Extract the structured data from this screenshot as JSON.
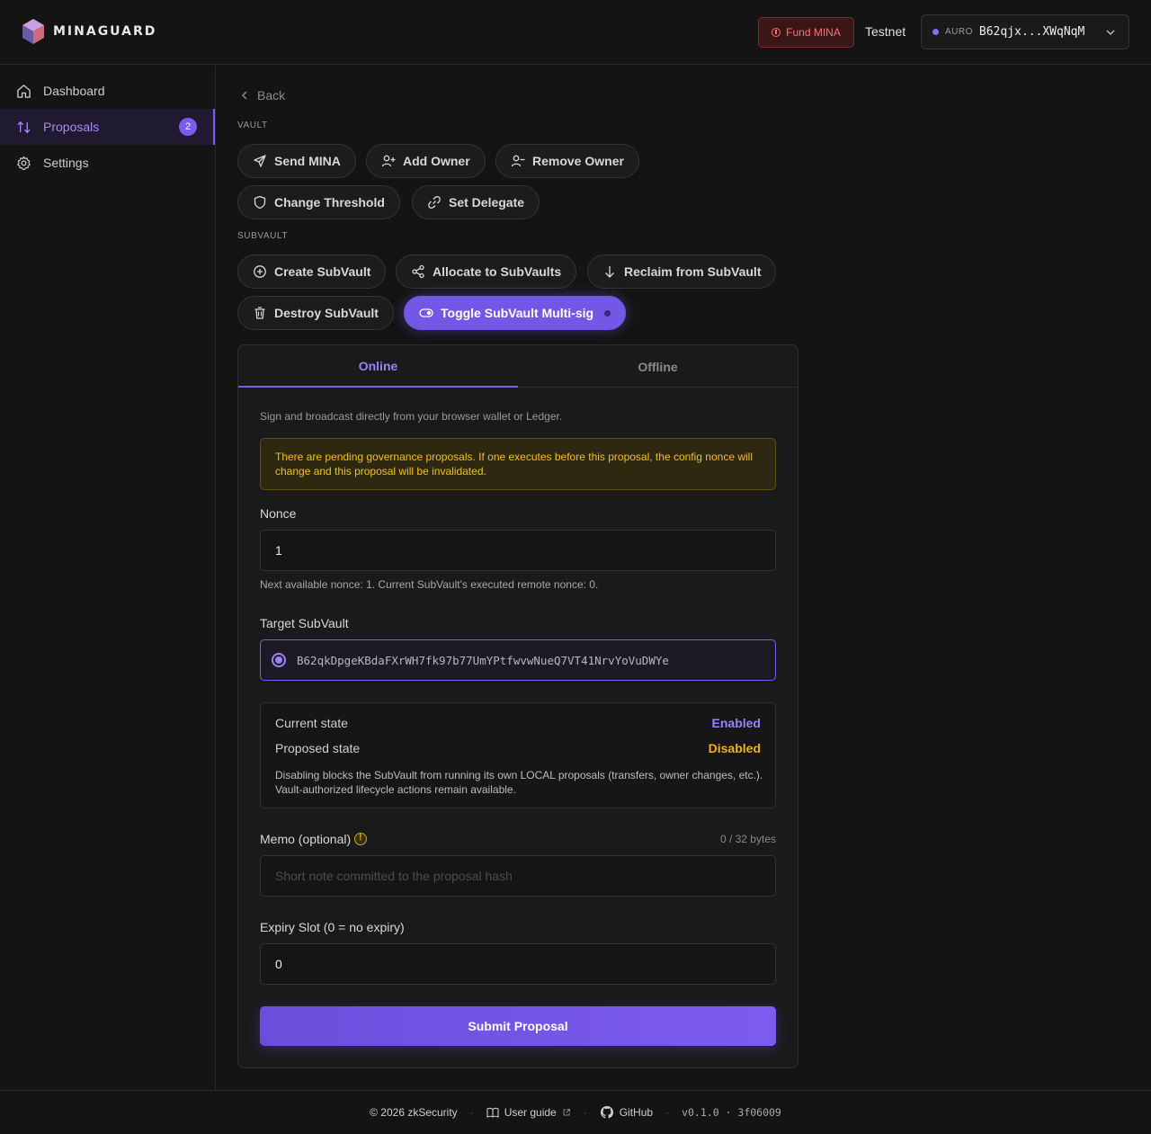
{
  "header": {
    "brand": "MINAGUARD",
    "fund_label": "Fund MINA",
    "network": "Testnet",
    "wallet_provider": "AURO",
    "wallet_address": "B62qjx...XWqNqM"
  },
  "sidebar": {
    "items": [
      {
        "label": "Dashboard",
        "icon": "home-icon"
      },
      {
        "label": "Proposals",
        "icon": "arrows-up-down-icon",
        "badge": "2"
      },
      {
        "label": "Settings",
        "icon": "gear-icon"
      }
    ]
  },
  "main": {
    "back_label": "Back",
    "vault_section": "VAULT",
    "vault_actions": [
      "Send MINA",
      "Add Owner",
      "Remove Owner",
      "Change Threshold",
      "Set Delegate"
    ],
    "subvault_section": "SUBVAULT",
    "subvault_actions": [
      "Create SubVault",
      "Allocate to SubVaults",
      "Reclaim from SubVault",
      "Destroy SubVault",
      "Toggle SubVault Multi-sig"
    ]
  },
  "form": {
    "tabs": [
      "Online",
      "Offline"
    ],
    "description": "Sign and broadcast directly from your browser wallet or Ledger.",
    "warning": "There are pending governance proposals. If one executes before this proposal, the config nonce will change and this proposal will be invalidated.",
    "nonce_label": "Nonce",
    "nonce_value": "1",
    "nonce_hint": "Next available nonce: 1. Current SubVault's executed remote nonce: 0.",
    "target_label": "Target SubVault",
    "target_address": "B62qkDpgeKBdaFXrWH7fk97b77UmYPtfwvwNueQ7VT41NrvYoVuDWYe",
    "current_state_label": "Current state",
    "current_state_value": "Enabled",
    "proposed_state_label": "Proposed state",
    "proposed_state_value": "Disabled",
    "state_note": "Disabling blocks the SubVault from running its own LOCAL proposals (transfers, owner changes, etc.). Vault-authorized lifecycle actions remain available.",
    "memo_label": "Memo (optional)",
    "memo_bytes": "0 / 32 bytes",
    "memo_placeholder": "Short note committed to the proposal hash",
    "expiry_label": "Expiry Slot (0 = no expiry)",
    "expiry_value": "0",
    "submit_label": "Submit Proposal"
  },
  "footer": {
    "copyright": "© 2026 zkSecurity",
    "guide": "User guide",
    "github": "GitHub",
    "version": "v0.1.0 · 3f06009"
  },
  "colors": {
    "accent": "#7c5cf0",
    "warning": "#f0c020",
    "danger": "#ff7070",
    "enabled": "#9b80ff",
    "disabled": "#f0b020"
  }
}
